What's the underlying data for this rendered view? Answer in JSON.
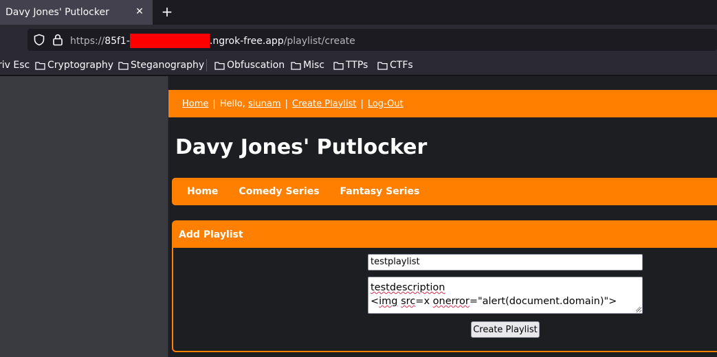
{
  "browser": {
    "tab": {
      "title": "Davy Jones' Putlocker",
      "close": "✕"
    },
    "new_tab": "+",
    "url": {
      "scheme": "https://",
      "host_prefix": "85f1-",
      "host_suffix": ".ngrok-free.app",
      "path": "/playlist/create"
    },
    "bookmarks": [
      {
        "label": "riv Esc",
        "folder": false
      },
      {
        "label": "Cryptography",
        "folder": true
      },
      {
        "label": "Steganography",
        "folder": true
      },
      {
        "label": "Obfuscation",
        "folder": true
      },
      {
        "label": "Misc",
        "folder": true
      },
      {
        "label": "TTPs",
        "folder": true
      },
      {
        "label": "CTFs",
        "folder": true
      }
    ]
  },
  "site": {
    "topbar": {
      "home": "Home",
      "sep": "|",
      "hello": "Hello,",
      "username": "siunam",
      "create_playlist": "Create Playlist",
      "logout": "Log-Out"
    },
    "title": "Davy Jones' Putlocker",
    "nav": [
      "Home",
      "Comedy Series",
      "Fantasy Series"
    ],
    "panel": {
      "header": "Add Playlist",
      "name_value": "testplaylist",
      "description_line1": "testdescription",
      "description_line2": {
        "open": "<",
        "tag": "img",
        "sp1": " ",
        "attr1": "src",
        "val1": "=x ",
        "attr2": "onerror",
        "val2": "=\"alert(document.domain)\">"
      },
      "submit": "Create Playlist"
    }
  },
  "colors": {
    "accent": "#ff7f00",
    "page_bg": "#1c1e22",
    "browser_bg": "#1c1b22",
    "redaction": "#ff0000"
  }
}
